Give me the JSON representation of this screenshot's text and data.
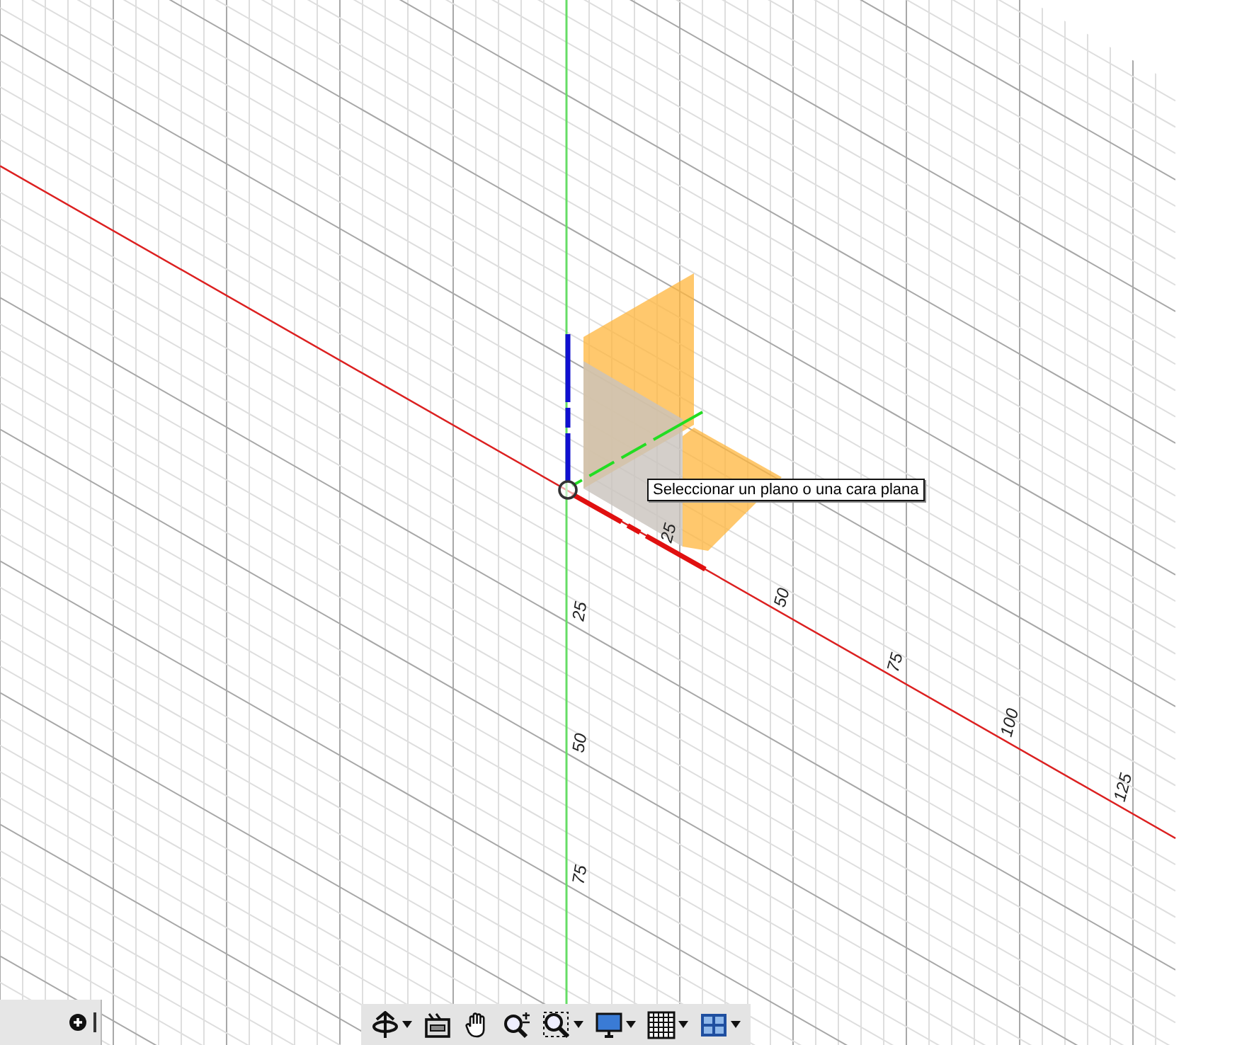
{
  "viewport": {
    "x_axis_labels": [
      "25",
      "50",
      "75",
      "100",
      "125"
    ],
    "y_axis_labels": [
      "25",
      "50",
      "75"
    ]
  },
  "tooltip": "Seleccionar un plano o una cara plana",
  "navigation_toolbar": [
    {
      "kind": "orbit",
      "dropdown": true
    },
    {
      "kind": "look",
      "dropdown": false
    },
    {
      "kind": "pan",
      "dropdown": false
    },
    {
      "kind": "zoom",
      "dropdown": false
    },
    {
      "kind": "fit",
      "dropdown": true
    },
    {
      "kind": "display",
      "dropdown": true
    },
    {
      "kind": "grid",
      "dropdown": true
    },
    {
      "kind": "viewports",
      "dropdown": true
    }
  ]
}
